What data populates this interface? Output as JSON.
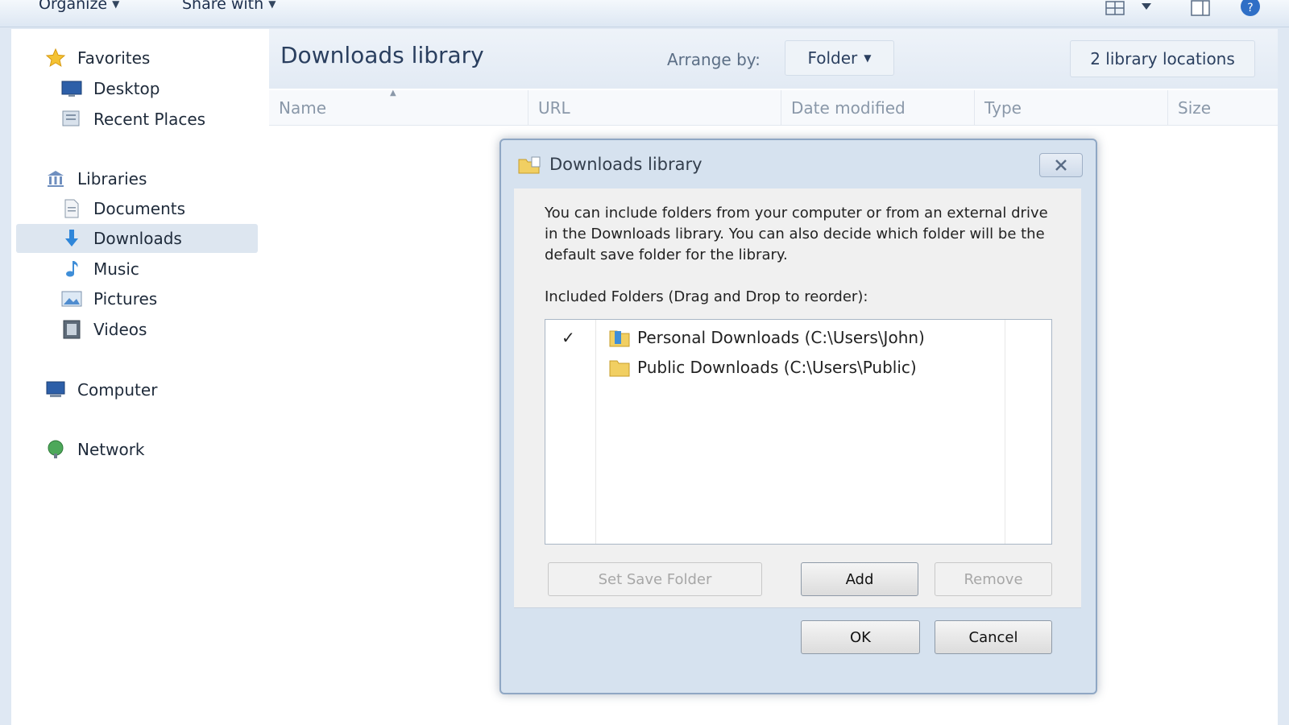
{
  "toolbar": {
    "organize": "Organize",
    "share_with": "Share with"
  },
  "nav": {
    "favorites": "Favorites",
    "desktop": "Desktop",
    "recent_places": "Recent Places",
    "libraries": "Libraries",
    "documents": "Documents",
    "downloads": "Downloads",
    "music": "Music",
    "pictures": "Pictures",
    "videos": "Videos",
    "computer": "Computer",
    "network": "Network"
  },
  "main": {
    "title": "Downloads library",
    "arrange_label": "Arrange by:",
    "arrange_value": "Folder",
    "locations": "2 library locations",
    "columns": [
      "Name",
      "URL",
      "Date modified",
      "Type",
      "Size"
    ]
  },
  "dialog": {
    "title": "Downloads library",
    "description": "You can include folders from your computer or from an external drive in the Downloads library. You can also decide which folder will be the default save folder for the library.",
    "included_label": "Included Folders (Drag and Drop to reorder):",
    "folders": [
      {
        "check": "✓",
        "name": "Personal Downloads (C:\\Users\\John)"
      },
      {
        "check": "",
        "name": "Public Downloads (C:\\Users\\Public)"
      }
    ],
    "set_save_folder": "Set Save Folder",
    "add": "Add",
    "remove": "Remove",
    "ok": "OK",
    "cancel": "Cancel"
  },
  "colors": {
    "accent": "#2a3f5f",
    "selection": "#dde6f0",
    "dialog_frame": "#d6e2ef"
  }
}
